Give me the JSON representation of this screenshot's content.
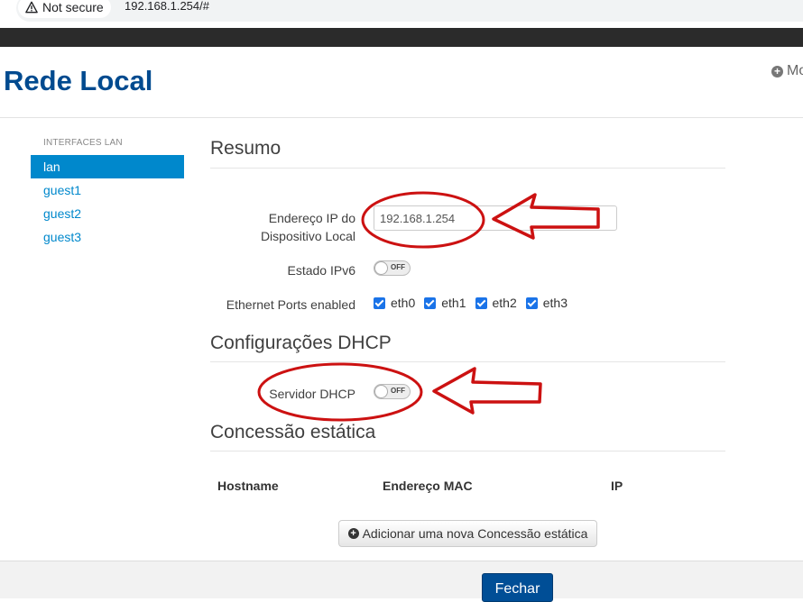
{
  "browser": {
    "security_label": "Not secure",
    "url": "192.168.1.254/#"
  },
  "header": {
    "title": "Rede Local",
    "more_label": "Mo"
  },
  "sidebar": {
    "heading": "INTERFACES LAN",
    "items": [
      {
        "label": "lan",
        "active": true
      },
      {
        "label": "guest1",
        "active": false
      },
      {
        "label": "guest2",
        "active": false
      },
      {
        "label": "guest3",
        "active": false
      }
    ]
  },
  "summary": {
    "title": "Resumo",
    "ip_label_line1": "Endereço IP do",
    "ip_label_line2": "Dispositivo Local",
    "ip_value": "192.168.1.254",
    "ipv6_label": "Estado IPv6",
    "ipv6_state": "OFF",
    "ports_label": "Ethernet Ports enabled",
    "ports": [
      {
        "name": "eth0",
        "checked": true
      },
      {
        "name": "eth1",
        "checked": true
      },
      {
        "name": "eth2",
        "checked": true
      },
      {
        "name": "eth3",
        "checked": true
      }
    ]
  },
  "dhcp": {
    "title": "Configurações DHCP",
    "server_label": "Servidor DHCP",
    "server_state": "OFF"
  },
  "static_lease": {
    "title": "Concessão estática",
    "columns": [
      "Hostname",
      "Endereço MAC",
      "IP"
    ],
    "add_button_label": "Adicionar uma nova Concessão estática"
  },
  "footer": {
    "close_label": "Fechar"
  },
  "colors": {
    "title_blue": "#004a8f",
    "link_blue": "#0088cc",
    "annotation_red": "#cc1111",
    "button_blue": "#004e96"
  }
}
